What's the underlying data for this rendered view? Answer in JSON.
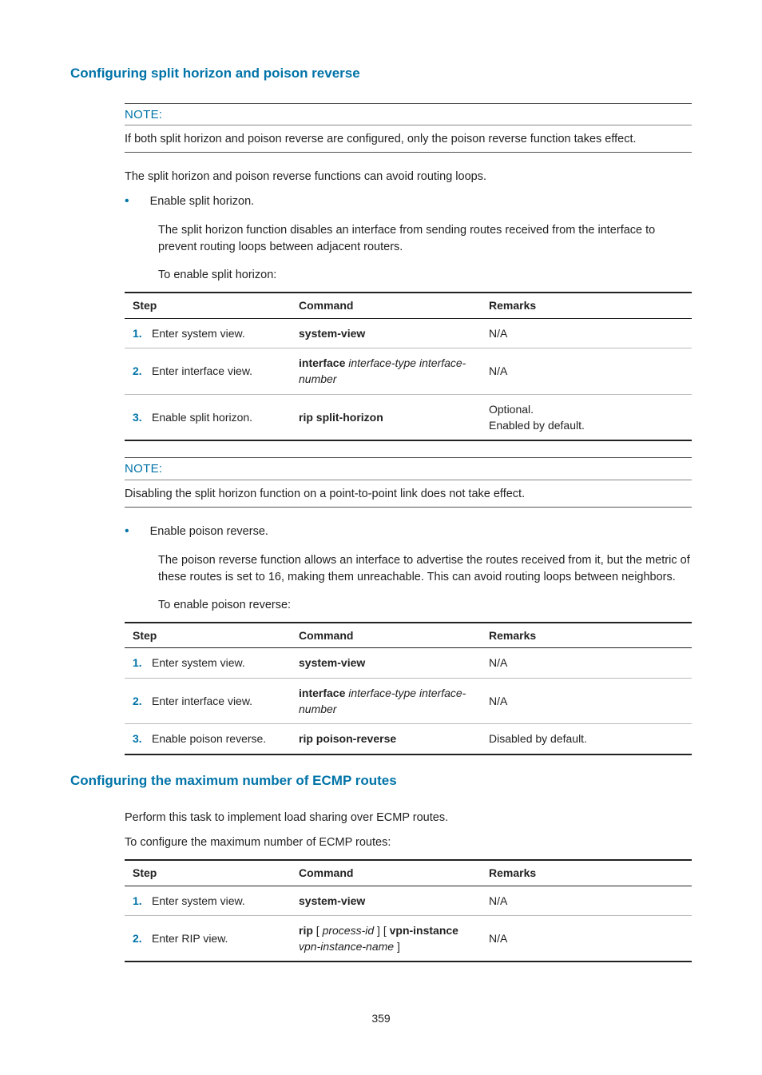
{
  "section1": {
    "heading": "Configuring split horizon and poison reverse",
    "note1_label": "NOTE:",
    "note1_text": "If both split horizon and poison reverse are configured, only the poison reverse function takes effect.",
    "intro": "The split horizon and poison reverse functions can avoid routing loops.",
    "bullet1": "Enable split horizon.",
    "bullet1_desc": "The split horizon function disables an interface from sending routes received from the interface to prevent routing loops between adjacent routers.",
    "bullet1_lead": "To enable split horizon:",
    "table1": {
      "headers": {
        "step": "Step",
        "command": "Command",
        "remarks": "Remarks"
      },
      "rows": [
        {
          "num": "1.",
          "desc": "Enter system view.",
          "cmd_bold": "system-view",
          "cmd_ital": "",
          "remarks": "N/A"
        },
        {
          "num": "2.",
          "desc": "Enter interface view.",
          "cmd_bold": "interface",
          "cmd_ital": "interface-type interface-number",
          "remarks": "N/A"
        },
        {
          "num": "3.",
          "desc": "Enable split horizon.",
          "cmd_bold": "rip split-horizon",
          "cmd_ital": "",
          "remarks": "Optional.\nEnabled by default."
        }
      ]
    },
    "note2_label": "NOTE:",
    "note2_text": "Disabling the split horizon function on a point-to-point link does not take effect.",
    "bullet2": "Enable poison reverse.",
    "bullet2_desc": "The poison reverse function allows an interface to advertise the routes received from it, but the metric of these routes is set to 16, making them unreachable. This can avoid routing loops between neighbors.",
    "bullet2_lead": "To enable poison reverse:",
    "table2": {
      "headers": {
        "step": "Step",
        "command": "Command",
        "remarks": "Remarks"
      },
      "rows": [
        {
          "num": "1.",
          "desc": "Enter system view.",
          "cmd_bold": "system-view",
          "cmd_ital": "",
          "remarks": "N/A"
        },
        {
          "num": "2.",
          "desc": "Enter interface view.",
          "cmd_bold": "interface",
          "cmd_ital": "interface-type interface-number",
          "remarks": "N/A"
        },
        {
          "num": "3.",
          "desc": "Enable poison reverse.",
          "cmd_bold": "rip poison-reverse",
          "cmd_ital": "",
          "remarks": "Disabled by default."
        }
      ]
    }
  },
  "section2": {
    "heading": "Configuring the maximum number of ECMP routes",
    "intro": "Perform this task to implement load sharing over ECMP routes.",
    "lead": "To configure the maximum number of ECMP routes:",
    "table": {
      "headers": {
        "step": "Step",
        "command": "Command",
        "remarks": "Remarks"
      },
      "rows": [
        {
          "num": "1.",
          "desc": "Enter system view.",
          "cmd_parts": [
            {
              "b": true,
              "t": "system-view"
            }
          ],
          "remarks": "N/A"
        },
        {
          "num": "2.",
          "desc": "Enter RIP view.",
          "cmd_parts": [
            {
              "b": true,
              "t": "rip"
            },
            {
              "b": false,
              "t": " [ "
            },
            {
              "i": true,
              "t": "process-id"
            },
            {
              "b": false,
              "t": " ] [ "
            },
            {
              "b": true,
              "t": "vpn-instance"
            },
            {
              "b": false,
              "t": " "
            },
            {
              "i": true,
              "t": "vpn-instance-name"
            },
            {
              "b": false,
              "t": " ]"
            }
          ],
          "remarks": "N/A"
        }
      ]
    }
  },
  "page_number": "359"
}
